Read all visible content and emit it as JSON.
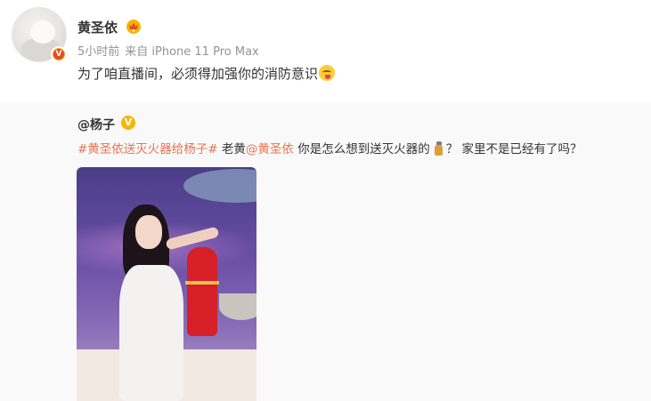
{
  "post": {
    "username": "黄圣依",
    "time": "5小时前",
    "source": "来自 iPhone 11 Pro Max",
    "text": "为了咱直播间，必须得加强你的消防意识",
    "avatar_badge": "V"
  },
  "repost": {
    "username": "@杨子",
    "verified_badge": "V",
    "hashtag": "#黄圣依送灭火器给杨子#",
    "text_part1": " 老黄",
    "mention": "@黄圣依",
    "text_part2": " 你是怎么想到送灭火器的",
    "text_part3": "？ 家里不是已经有了吗？"
  },
  "colors": {
    "link_orange": "#eb7350",
    "meta_gray": "#939393",
    "repost_bg": "#f9f9f9",
    "gold_badge": "#f7b500"
  },
  "icons": {
    "crown": "crown-icon",
    "tongue_emoji": "tongue-emoji-icon",
    "extinguisher_emoji": "extinguisher-emoji-icon"
  }
}
